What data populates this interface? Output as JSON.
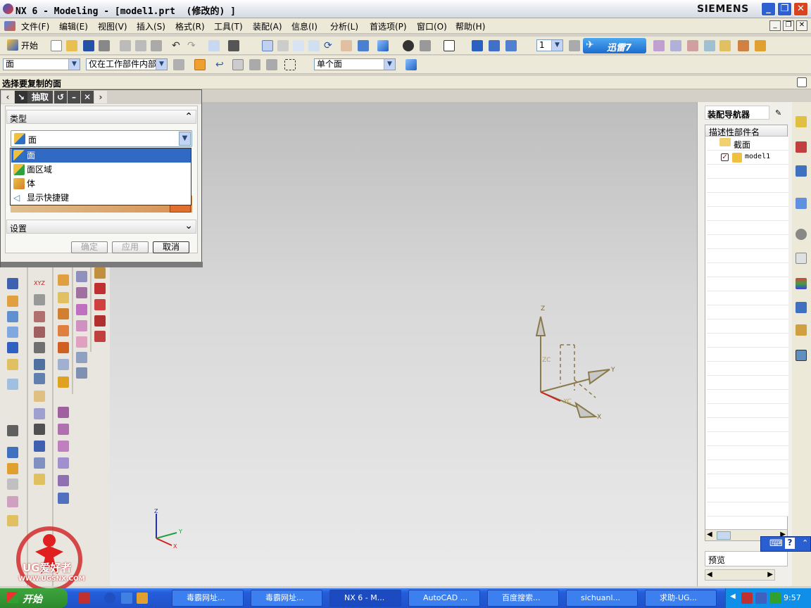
{
  "window": {
    "title": "NX 6 - Modeling - [model1.prt  (修改的) ]",
    "brand": "SIEMENS"
  },
  "menubar": {
    "items": [
      "文件(F)",
      "编辑(E)",
      "视图(V)",
      "插入(S)",
      "格式(R)",
      "工具(T)",
      "装配(A)",
      "信息(I)",
      "分析(L)",
      "首选项(P)",
      "窗口(O)",
      "帮助(H)"
    ]
  },
  "toolbar1": {
    "start_label": "开始",
    "layer_value": "1",
    "xunlei_label": "迅雷7"
  },
  "toolbar2": {
    "filter_value": "面",
    "scope_value": "仅在工作部件内部",
    "rule_value": "单个面"
  },
  "cue": {
    "text": "选择要复制的面"
  },
  "dialog": {
    "title": "抽取",
    "type_section": "类型",
    "type_value": "面",
    "settings_section": "设置",
    "ok_label": "确定",
    "apply_label": "应用",
    "cancel_label": "取消",
    "dropdown_items": [
      {
        "label": "面",
        "selected": true
      },
      {
        "label": "面区域",
        "selected": false
      },
      {
        "label": "体",
        "selected": false
      },
      {
        "label": "显示快捷键",
        "selected": false
      }
    ]
  },
  "navigator": {
    "title": "装配导航器",
    "column_header": "描述性部件名",
    "nodes": [
      {
        "label": "截面"
      },
      {
        "label": "model1"
      }
    ],
    "preview_label": "预览"
  },
  "axes": {
    "z": "Z",
    "y": "Y",
    "x": "X",
    "zc": "ZC",
    "xc": "XC"
  },
  "watermark": {
    "text": "UG爱好者",
    "url": "WWW.UGSNX.COM"
  },
  "taskbar": {
    "start": "开始",
    "tasks": [
      "毒霸网址...",
      "毒霸网址...",
      "NX 6 - M...",
      "AutoCAD ...",
      "百度搜索...",
      "sichuanl...",
      "求助-UG..."
    ],
    "clock": "9:57"
  },
  "colors": {
    "selection": "#316ac5",
    "taskbar": "#245edb",
    "close": "#d9431d"
  }
}
